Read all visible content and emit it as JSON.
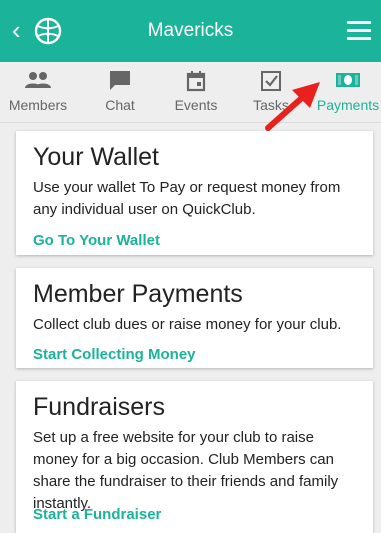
{
  "header": {
    "title": "Mavericks",
    "back_icon": "chevron-left-icon",
    "logo_icon": "club-logo-icon",
    "menu_icon": "hamburger-menu-icon"
  },
  "tabs": [
    {
      "label": "Members",
      "icon": "people-icon"
    },
    {
      "label": "Chat",
      "icon": "chat-icon"
    },
    {
      "label": "Events",
      "icon": "calendar-icon"
    },
    {
      "label": "Tasks",
      "icon": "checkbox-icon"
    },
    {
      "label": "Payments",
      "icon": "money-icon",
      "active": true
    }
  ],
  "cards": [
    {
      "title": "Your Wallet",
      "text": "Use your wallet To Pay or request money from any individual user on QuickClub.",
      "link": "Go To Your Wallet"
    },
    {
      "title": "Member Payments",
      "text": "Collect club dues or raise money for your club.",
      "link": "Start Collecting Money"
    },
    {
      "title": "Fundraisers",
      "text": "Set up a free website for your club to raise money for a big occasion. Club Members can share the fundraiser to their friends and family instantly.",
      "link": "Start a Fundraiser"
    }
  ],
  "colors": {
    "accent": "#1bb39a",
    "annotation_arrow": "#e8211f"
  }
}
